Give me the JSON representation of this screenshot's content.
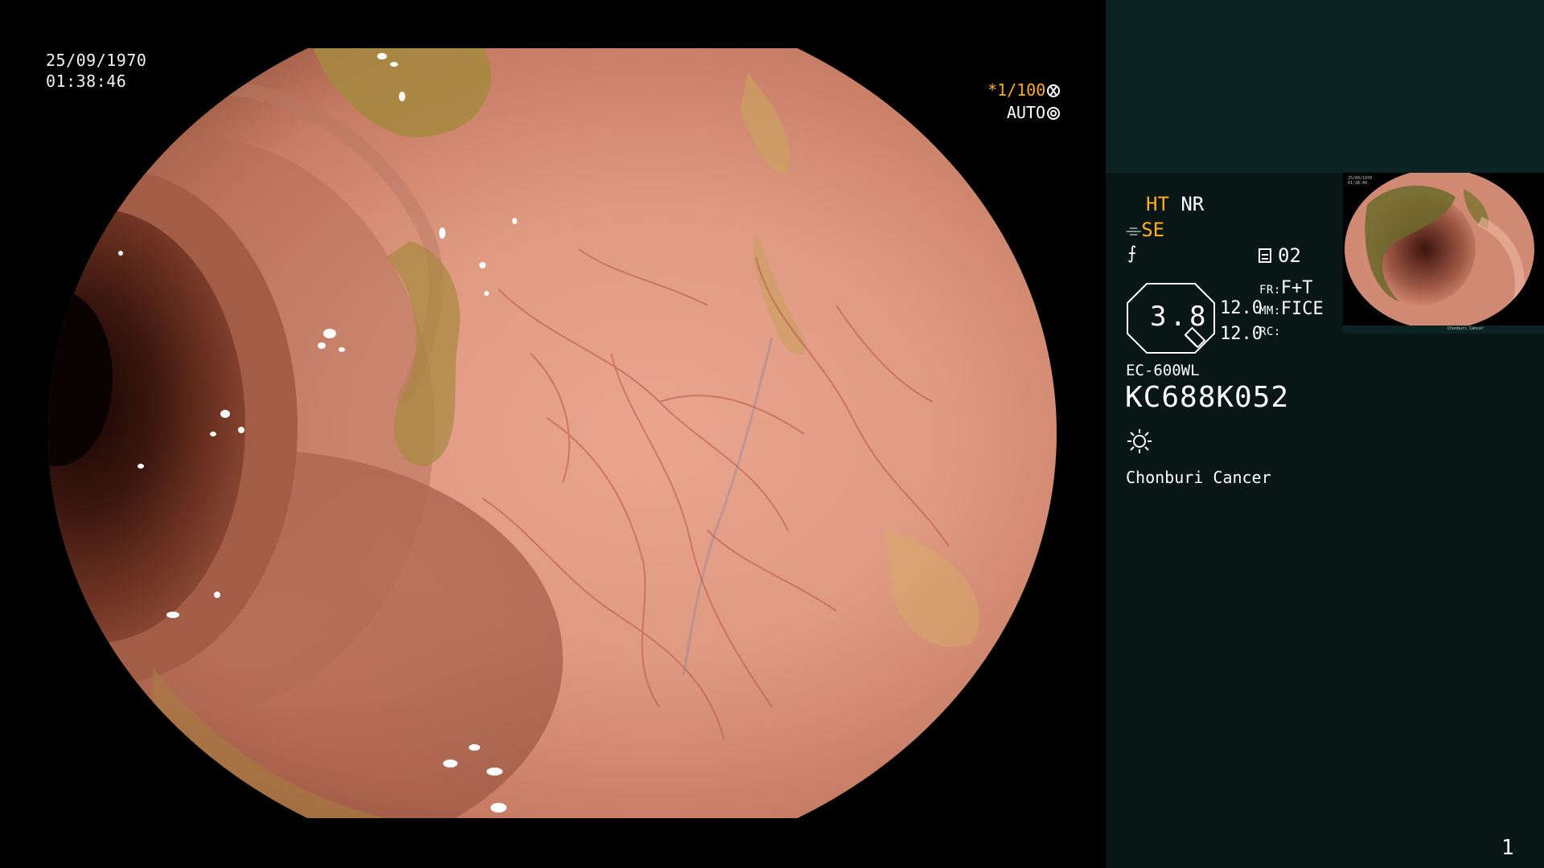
{
  "capture": {
    "date": "25/09/1970",
    "time": "01:38:46"
  },
  "shutter": {
    "speed": "*1/100",
    "iris_mode": "AUTO",
    "speed_icon": "aperture-icon",
    "iris_icon": "iris-ring-icon"
  },
  "modes": {
    "ht": "HT",
    "nr": "NR",
    "se": "SE",
    "se_icon": "structure-enhance-icon",
    "freeze_icon": "freeze-icon"
  },
  "memo": {
    "icon": "memory-card-icon",
    "value": "02"
  },
  "zoom": {
    "value": "3.8"
  },
  "processing": {
    "value_1": "12.0",
    "value_2": "12.0",
    "fr_label": "FR:",
    "fr_value": "F+T",
    "mm_label": "MM:",
    "mm_value": "FICE",
    "rc_label": "RC:",
    "rc_value": ""
  },
  "scope": {
    "model": "EC-600WL",
    "serial": "KC688K052",
    "light_icon": "light-source-icon"
  },
  "hospital": "Chonburi Cancer",
  "page_number": "1",
  "colors": {
    "accent_orange": "#ffae17",
    "panel_top": "#0c2323",
    "panel_main": "#091616",
    "background": "#000000"
  }
}
